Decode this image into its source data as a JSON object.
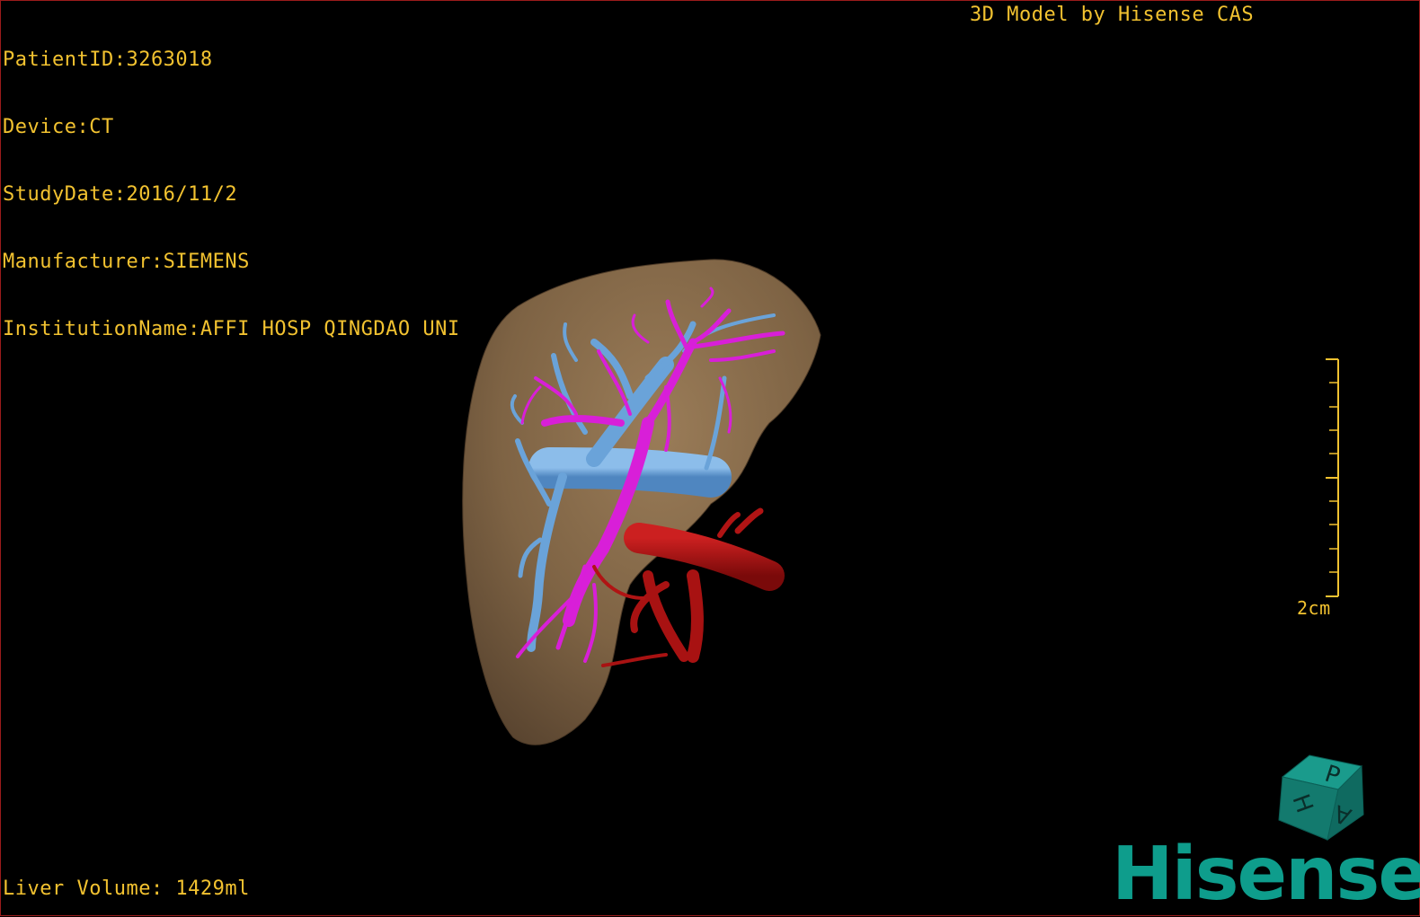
{
  "study_info": {
    "patient_id": "PatientID:3263018",
    "device": "Device:CT",
    "study_date": "StudyDate:2016/11/2",
    "manufacturer": "Manufacturer:SIEMENS",
    "institution": "InstitutionName:AFFI HOSP QINGDAO UNI"
  },
  "viewer_title": "3D Model by Hisense CAS",
  "liver_volume": "Liver Volume: 1429ml",
  "scale_bar": {
    "label": "2cm"
  },
  "orientation_cube": {
    "faces": [
      "P",
      "H",
      "A"
    ]
  },
  "logo": {
    "text": "Hisense"
  },
  "colors": {
    "overlay_text": "#f2c230",
    "liver": "#8b6e4e",
    "portal_vein": "#6aa3d9",
    "hepatic_artery": "#b01414",
    "biliary_vessels": "#d81fd8",
    "brand": "#0e9d8c"
  },
  "model_parts": [
    "liver-surface",
    "portal-vein",
    "hepatic-vessels",
    "hepatic-artery"
  ]
}
